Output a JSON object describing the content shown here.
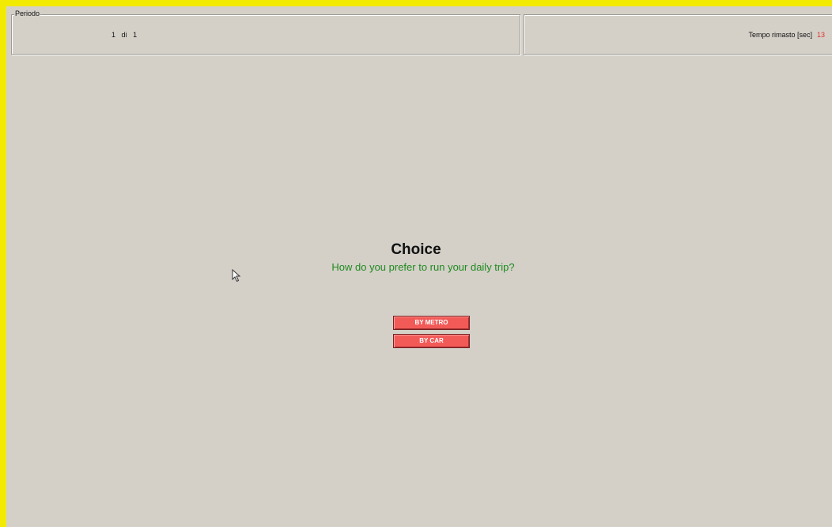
{
  "header": {
    "period_title": "Periodo",
    "period_current": "1",
    "period_sep": "di",
    "period_total": "1",
    "time_label": "Tempo rimasto [sec]",
    "time_value": "13"
  },
  "main": {
    "title": "Choice",
    "question": "How do you prefer to run your daily trip?",
    "options": [
      {
        "label": "BY METRO"
      },
      {
        "label": "BY CAR"
      }
    ]
  },
  "colors": {
    "window_border": "#f2ea00",
    "background": "#d4d0c8",
    "button": "#f25a58",
    "question_text": "#1e8a1e",
    "timer_value": "#e03030"
  },
  "icons": {
    "cursor": "mouse-pointer-icon"
  }
}
